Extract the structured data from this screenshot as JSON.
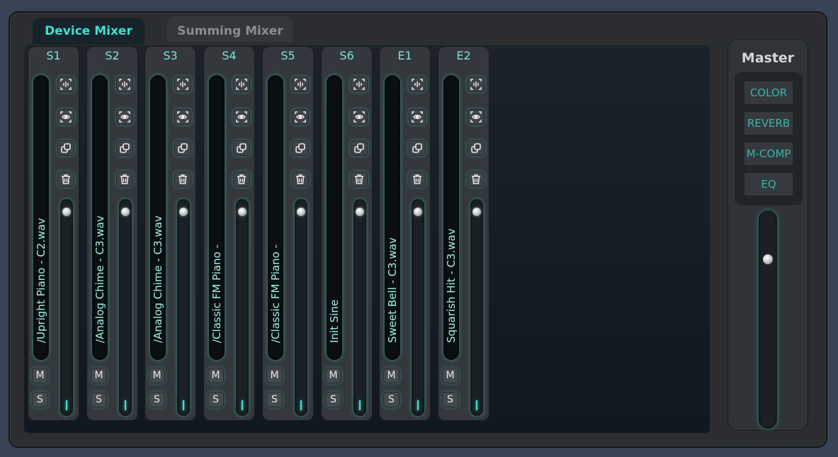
{
  "tabs": {
    "device_mixer": "Device Mixer",
    "summing_mixer": "Summing Mixer"
  },
  "strips": [
    {
      "label": "S1",
      "name": "/Upright Piano - C2.wav"
    },
    {
      "label": "S2",
      "name": "/Analog Chime - C3.wav"
    },
    {
      "label": "S3",
      "name": "/Analog Chime - C3.wav"
    },
    {
      "label": "S4",
      "name": "/Classic FM Piano -"
    },
    {
      "label": "S5",
      "name": "/Classic FM Piano -"
    },
    {
      "label": "S6",
      "name": "Init Sine"
    },
    {
      "label": "E1",
      "name": "Sweet Bell - C3.wav"
    },
    {
      "label": "E2",
      "name": "Squarish Hit - C3.wav"
    }
  ],
  "strip_buttons": {
    "mute": "M",
    "solo": "S"
  },
  "strip_icons": [
    "waveform-icon",
    "eye-icon",
    "duplicate-icon",
    "trash-icon"
  ],
  "master": {
    "title": "Master",
    "fx": [
      "COLOR",
      "REVERB",
      "M-COMP",
      "EQ"
    ]
  },
  "colors": {
    "accent": "#3ee0cf",
    "label_text": "#7fe6d8",
    "fx_text": "#3ab5a8",
    "background": "#3a4255"
  }
}
